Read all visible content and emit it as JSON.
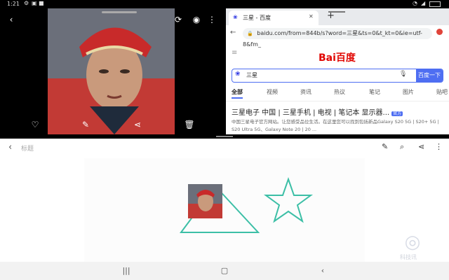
{
  "status": {
    "time": "1:21"
  },
  "browser": {
    "tab_title": "三星 - 百度",
    "url": "baidu.com/from=844b/s?word=三星&ts=0&t_kt=0&ie=utf-8&fm_",
    "logo": "Bai百度",
    "search_value": "三星",
    "search_button": "百度一下",
    "tabs": [
      "全部",
      "视频",
      "资讯",
      "热议",
      "笔记",
      "图片",
      "贴吧"
    ],
    "result_title": "三星电子 中国 | 三星手机 | 电视 | 笔记本 显示器...",
    "result_badge": "官方",
    "result_desc": "中国三星电子官方网站。让您感受品位生活。在这里您可以找到包括新品Galaxy S20 5G | S20+ 5G | S20 Ultra 5G、Galaxy Note 20 | 20 ..."
  },
  "note": {
    "title_placeholder": "标题",
    "shapes": [
      "triangle",
      "star"
    ],
    "stroke_color": "#3cbfa6"
  },
  "watermark": "科技讯"
}
